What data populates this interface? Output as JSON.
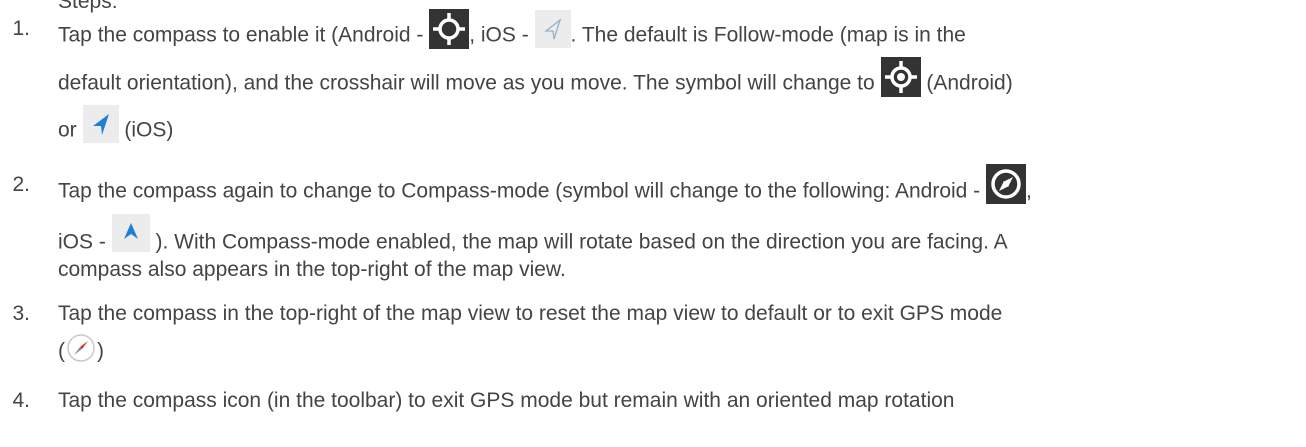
{
  "intro": {
    "partial_text": "Steps:"
  },
  "steps": [
    {
      "number": "1.",
      "line1_a": "Tap the compass to enable it (Android - ",
      "line1_b": ", iOS - ",
      "line1_c": ".  The default is Follow-mode (map is in the",
      "line2_a": "default orientation), and the crosshair will move as you move.  The symbol will change to ",
      "line2_b": " (Android)",
      "line3_a": "or ",
      "line3_b": " (iOS)"
    },
    {
      "number": "2.",
      "line1_a": "Tap the compass again to change to Compass-mode (symbol will change to the following: Android - ",
      "line1_b": ",",
      "line2_a": "iOS - ",
      "line2_b": " ).  With Compass-mode enabled, the map will rotate based on the direction you are facing.  A",
      "line3": "compass also appears in the top-right of the map view."
    },
    {
      "number": "3.",
      "line1": "Tap the compass in the top-right of the map view to reset the map view to default or to exit GPS mode",
      "line2_a": "(",
      "line2_b": ")"
    },
    {
      "number": "4.",
      "line1": "Tap the compass icon (in the toolbar) to exit GPS mode but remain with an oriented map rotation"
    }
  ],
  "icons": {
    "android_gps_off": "gps-crosshair-outline-icon",
    "ios_location_outline": "location-arrow-outline-icon",
    "android_gps_on": "gps-crosshair-filled-icon",
    "ios_location_filled": "location-arrow-filled-icon",
    "android_compass": "compass-needle-icon",
    "ios_compass_heading": "heading-arrow-icon",
    "map_compass_reset": "map-compass-icon"
  },
  "colors": {
    "text": "#444444",
    "android_icon_bg": "#333333",
    "ios_icon_bg": "#e8e8e8",
    "ios_arrow_blue": "#1f7fd6",
    "compass_red": "#d9262c"
  }
}
